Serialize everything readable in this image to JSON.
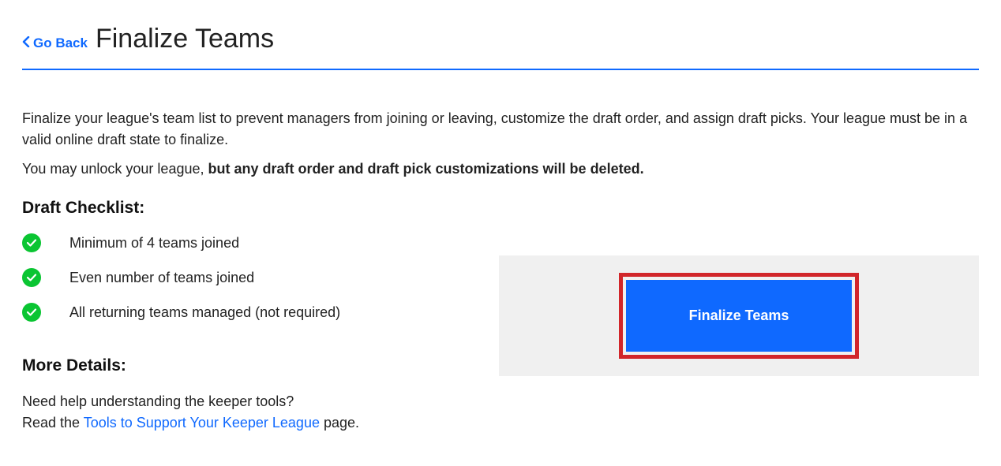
{
  "header": {
    "go_back_label": "Go Back",
    "page_title": "Finalize Teams"
  },
  "intro": {
    "line1": "Finalize your league's team list to prevent managers from joining or leaving, customize the draft order, and assign draft picks. Your league must be in a valid online draft state to finalize.",
    "line2_prefix": "You may unlock your league, ",
    "line2_bold": "but any draft order and draft pick customizations will be deleted."
  },
  "checklist": {
    "heading": "Draft Checklist:",
    "items": [
      {
        "label": "Minimum of 4 teams joined"
      },
      {
        "label": "Even number of teams joined"
      },
      {
        "label": "All returning teams managed (not required)"
      }
    ]
  },
  "more_details": {
    "heading": "More Details:",
    "line1": "Need help understanding the keeper tools?",
    "line2_prefix": "Read the ",
    "link_text": "Tools to Support Your Keeper League",
    "line2_suffix": " page."
  },
  "action": {
    "finalize_label": "Finalize Teams"
  }
}
